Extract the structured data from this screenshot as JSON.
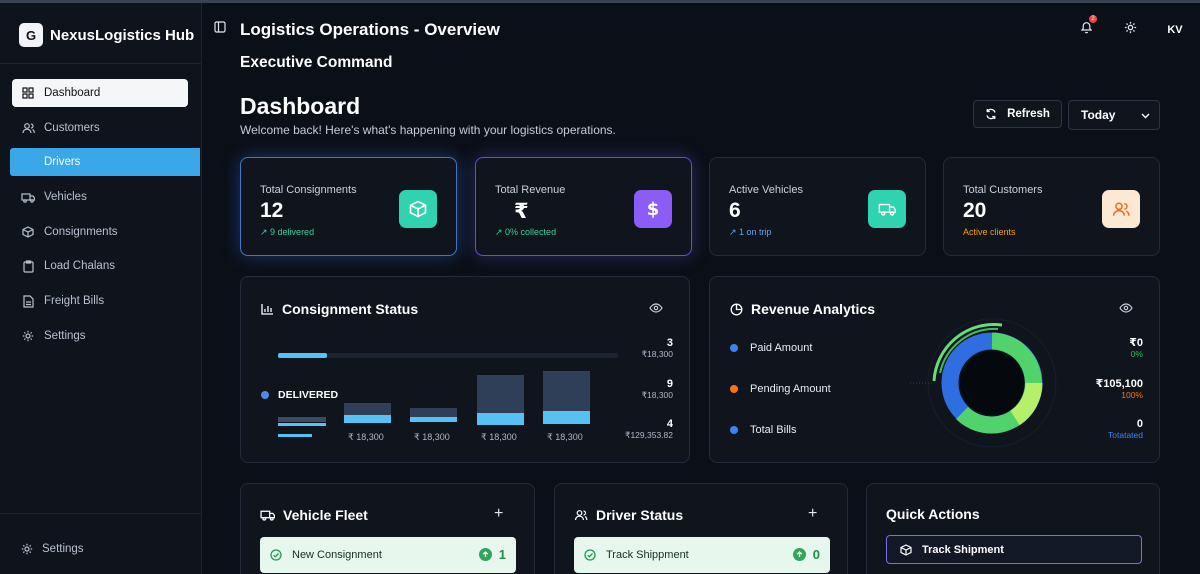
{
  "brand": {
    "logo_letter": "G",
    "name": "NexusLogistics Hub"
  },
  "sidebar": {
    "items": [
      {
        "label": "Dashboard",
        "icon": "grid-icon",
        "state": "selected-white"
      },
      {
        "label": "Customers",
        "icon": "users-icon",
        "state": "normal"
      },
      {
        "label": "Drivers",
        "icon": "steering-icon",
        "state": "active-blue"
      },
      {
        "label": "Vehicles",
        "icon": "truck-icon",
        "state": "normal"
      },
      {
        "label": "Consignments",
        "icon": "box-icon",
        "state": "normal"
      },
      {
        "label": "Load Chalans",
        "icon": "clipboard-icon",
        "state": "normal"
      },
      {
        "label": "Freight Bills",
        "icon": "document-icon",
        "state": "normal"
      },
      {
        "label": "Settings",
        "icon": "gear-icon",
        "state": "normal"
      }
    ],
    "footer_settings": "Settings"
  },
  "header": {
    "title": "Logistics Operations - Overview",
    "subtitle": "Executive Command",
    "notification_count": "2",
    "avatar_initials": "KV"
  },
  "page": {
    "title": "Dashboard",
    "welcome": "Welcome back! Here's what's happening with your logistics operations.",
    "refresh_label": "Refresh",
    "range_value": "Today"
  },
  "stats": [
    {
      "label": "Total Consignments",
      "value": "12",
      "note": "↗ 9 delivered",
      "note_color": "#34d399",
      "icon": "package-icon",
      "icon_bg": "#2fd3b0"
    },
    {
      "label": "Total Revenue",
      "value": "₹",
      "note": "↗ 0% collected",
      "note_color": "#34d399",
      "icon": "dollar-icon",
      "icon_bg": "#8b5cf6"
    },
    {
      "label": "Active Vehicles",
      "value": "6",
      "note": "↗ 1 on trip",
      "note_color": "#60a5fa",
      "icon": "truck-icon",
      "icon_bg": "#2fd3b0"
    },
    {
      "label": "Total Customers",
      "value": "20",
      "note": "Active clients",
      "note_color": "#f59e0b",
      "icon": "users-icon",
      "icon_bg": "#fde8d4"
    }
  ],
  "consignment_status": {
    "title": "Consignment Status",
    "status_label": "DELIVERED",
    "right_values": [
      {
        "count": "3",
        "amount": "₹18,300"
      },
      {
        "count": "9",
        "amount": "₹18,300"
      },
      {
        "count": "4",
        "amount": "₹129,353.82"
      }
    ],
    "bottom_labels": [
      "₹ 18,300",
      "₹ 18,300",
      "₹ 18,300",
      "₹ 18,300"
    ]
  },
  "revenue_analytics": {
    "title": "Revenue Analytics",
    "legend": [
      {
        "label": "Paid Amount",
        "color": "#3b82f6"
      },
      {
        "label": "Pending Amount",
        "color": "#f97316"
      },
      {
        "label": "Total Bills",
        "color": "#3b82f6"
      }
    ],
    "values": [
      {
        "amount": "₹0",
        "sub": "0%",
        "sub_color": "#22c55e"
      },
      {
        "amount": "₹105,100",
        "sub": "100%",
        "sub_color": "#f97316"
      },
      {
        "amount": "0",
        "sub": "Totatated",
        "sub_color": "#3b82f6"
      }
    ]
  },
  "vehicle_fleet": {
    "title": "Vehicle Fleet",
    "row_label": "New Consignment",
    "row_count": "1"
  },
  "driver_status": {
    "title": "Driver Status",
    "row_label": "Track Shippment",
    "row_count": "0"
  },
  "quick_actions": {
    "title": "Quick Actions",
    "button_label": "Track Shipment"
  }
}
